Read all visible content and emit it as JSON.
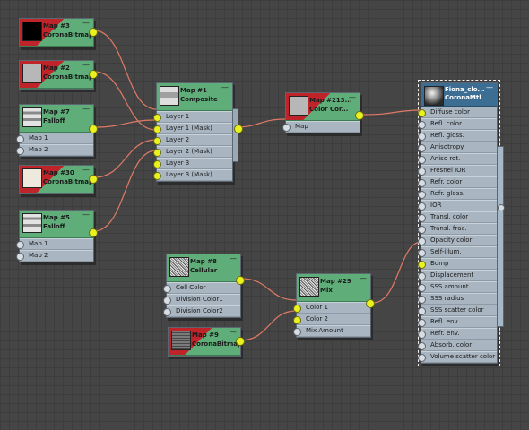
{
  "nodes": {
    "map3": {
      "title": "Map #3",
      "subtitle": "CoronaBitmap"
    },
    "map2": {
      "title": "Map #2",
      "subtitle": "CoronaBitmap"
    },
    "map7": {
      "title": "Map #7",
      "subtitle": "Falloff",
      "ports": [
        "Map 1",
        "Map 2"
      ]
    },
    "map30": {
      "title": "Map #30",
      "subtitle": "CoronaBitmap"
    },
    "map5": {
      "title": "Map #5",
      "subtitle": "Falloff",
      "ports": [
        "Map 1",
        "Map 2"
      ]
    },
    "map1": {
      "title": "Map #1",
      "subtitle": "Composite",
      "ports": [
        "Layer 1",
        "Layer 1 (Mask)",
        "Layer 2",
        "Layer 2 (Mask)",
        "Layer 3",
        "Layer 3 (Mask)"
      ]
    },
    "map213": {
      "title": "Map #213...",
      "subtitle": "Color Cor...",
      "ports": [
        "Map"
      ]
    },
    "map8": {
      "title": "Map #8",
      "subtitle": "Cellular",
      "ports": [
        "Cell Color",
        "Division Color1",
        "Division Color2"
      ]
    },
    "map29": {
      "title": "Map #29",
      "subtitle": "Mix",
      "ports": [
        "Color 1",
        "Color 2",
        "Mix Amount"
      ]
    },
    "map9": {
      "title": "Map #9",
      "subtitle": "CoronaBitmap"
    },
    "fiona": {
      "title": "Fiona_clo...",
      "subtitle": "CoronaMtl",
      "ports": [
        "Diffuse color",
        "Refl. color",
        "Refl. gloss.",
        "Anisotropy",
        "Aniso rot.",
        "Fresnel IOR",
        "Refr. color",
        "Refr. gloss.",
        "IOR",
        "Transl. color",
        "Transl. frac.",
        "Opacity color",
        "Self-illum.",
        "Bump",
        "Displacement",
        "SSS amount",
        "SSS radius",
        "SSS scatter color",
        "Refl. env.",
        "Refr. env.",
        "Absorb. color",
        "Volume scatter color"
      ]
    }
  },
  "minimize_glyph": "—",
  "colors": {
    "canvas": "#454545",
    "node_header": "#5fae79",
    "wire": "#e07a66",
    "socket_active": "#e9f21f",
    "material_header": "#3c6e93"
  }
}
